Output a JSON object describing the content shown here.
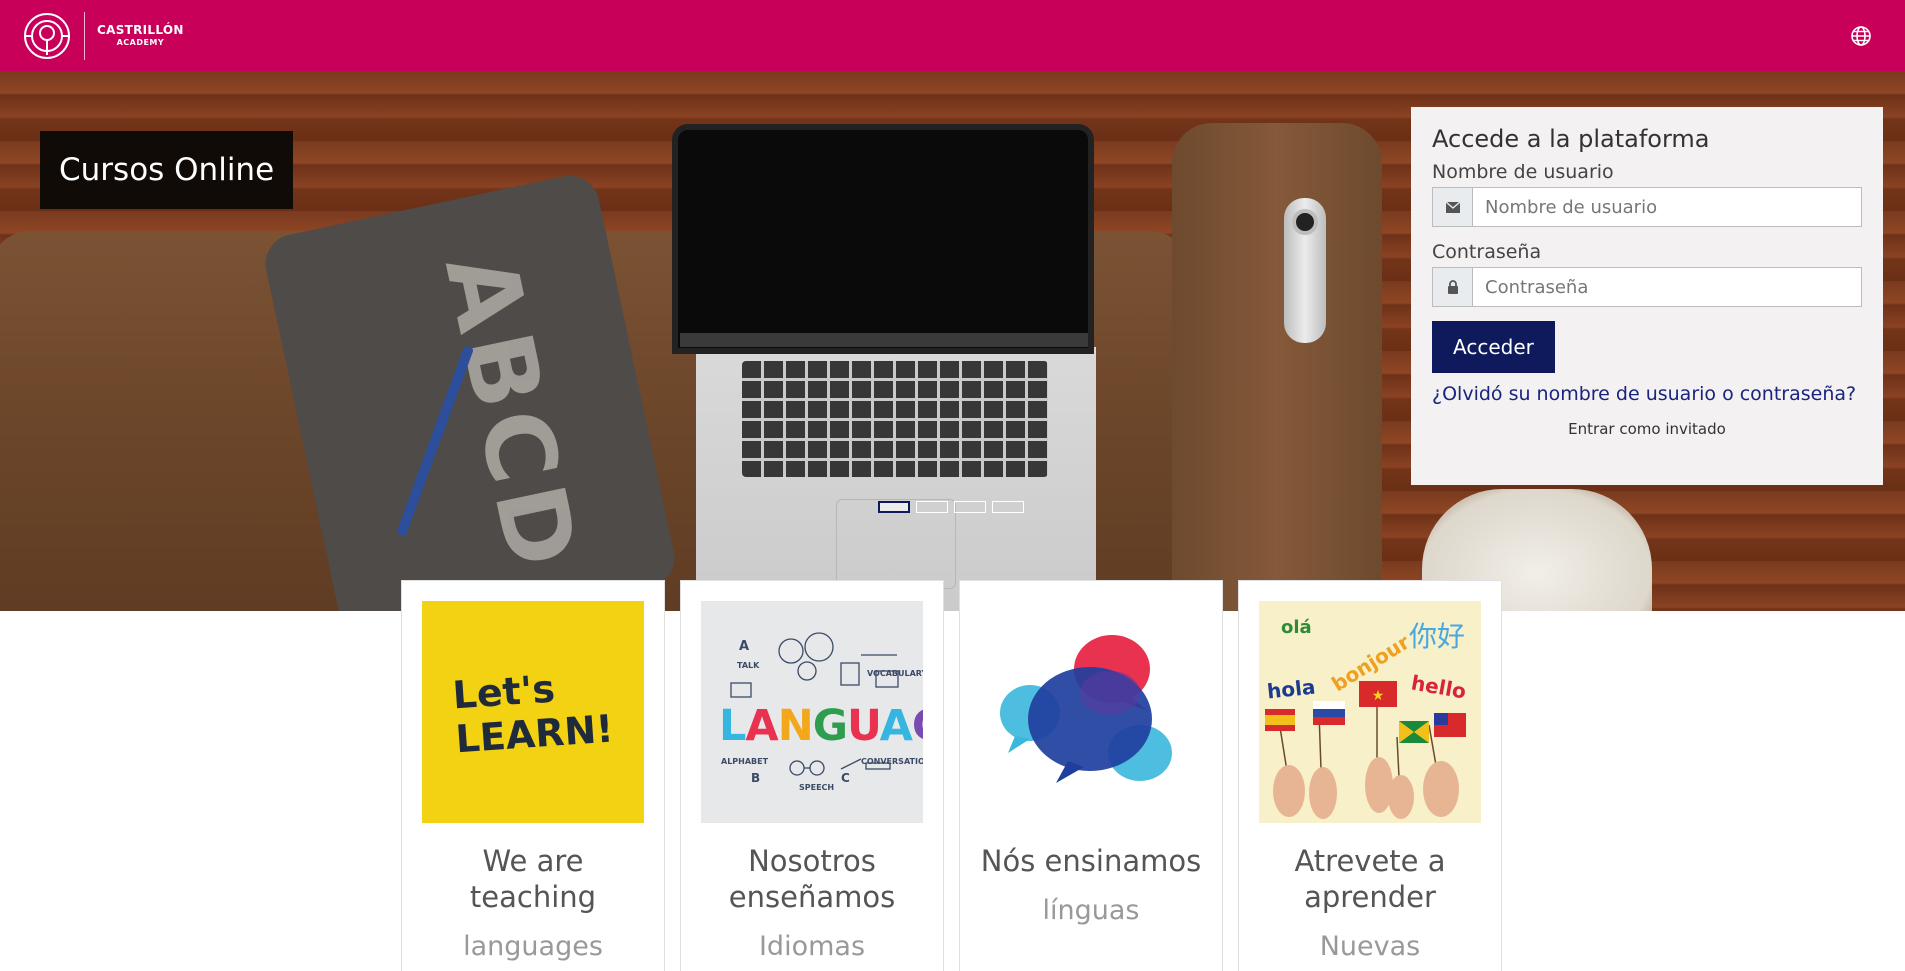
{
  "brand": {
    "line1": "CASTRILLÓN",
    "line2": "ACADEMY",
    "logo_icon": "castrillon-logo-icon",
    "color": "#c8005a"
  },
  "navbar": {
    "language_icon": "globe-icon"
  },
  "hero": {
    "title": "Cursos Online",
    "slides": 4,
    "active_slide": 1
  },
  "login": {
    "heading": "Accede a la plataforma",
    "username_label": "Nombre de usuario",
    "username_placeholder": "Nombre de usuario",
    "username_value": "",
    "username_icon": "envelope-icon",
    "password_label": "Contraseña",
    "password_placeholder": "Contraseña",
    "password_value": "",
    "password_icon": "lock-icon",
    "submit_label": "Acceder",
    "forgot_link": "¿Olvidó su nombre de usuario o contraseña?",
    "guest_link": "Entrar como invitado",
    "button_color": "#0e1a5c"
  },
  "cards": [
    {
      "image_text_1": "Let's",
      "image_text_2": "LEARN!",
      "title": "We are teaching",
      "subtitle": "languages"
    },
    {
      "image_text": "LANGUAGE",
      "labels": [
        "A",
        "TALK",
        "VOCABULARY",
        "ALPHABET",
        "B",
        "SPEECH",
        "C",
        "CONVERSATION"
      ],
      "title": "Nosotros enseñamos",
      "subtitle": "Idiomas"
    },
    {
      "title": "Nós ensinamos",
      "subtitle": "línguas"
    },
    {
      "words": [
        "olá",
        "你好",
        "hola",
        "bonjour",
        "hello"
      ],
      "title": "Atrevete a aprender",
      "subtitle": "Nuevas"
    }
  ]
}
